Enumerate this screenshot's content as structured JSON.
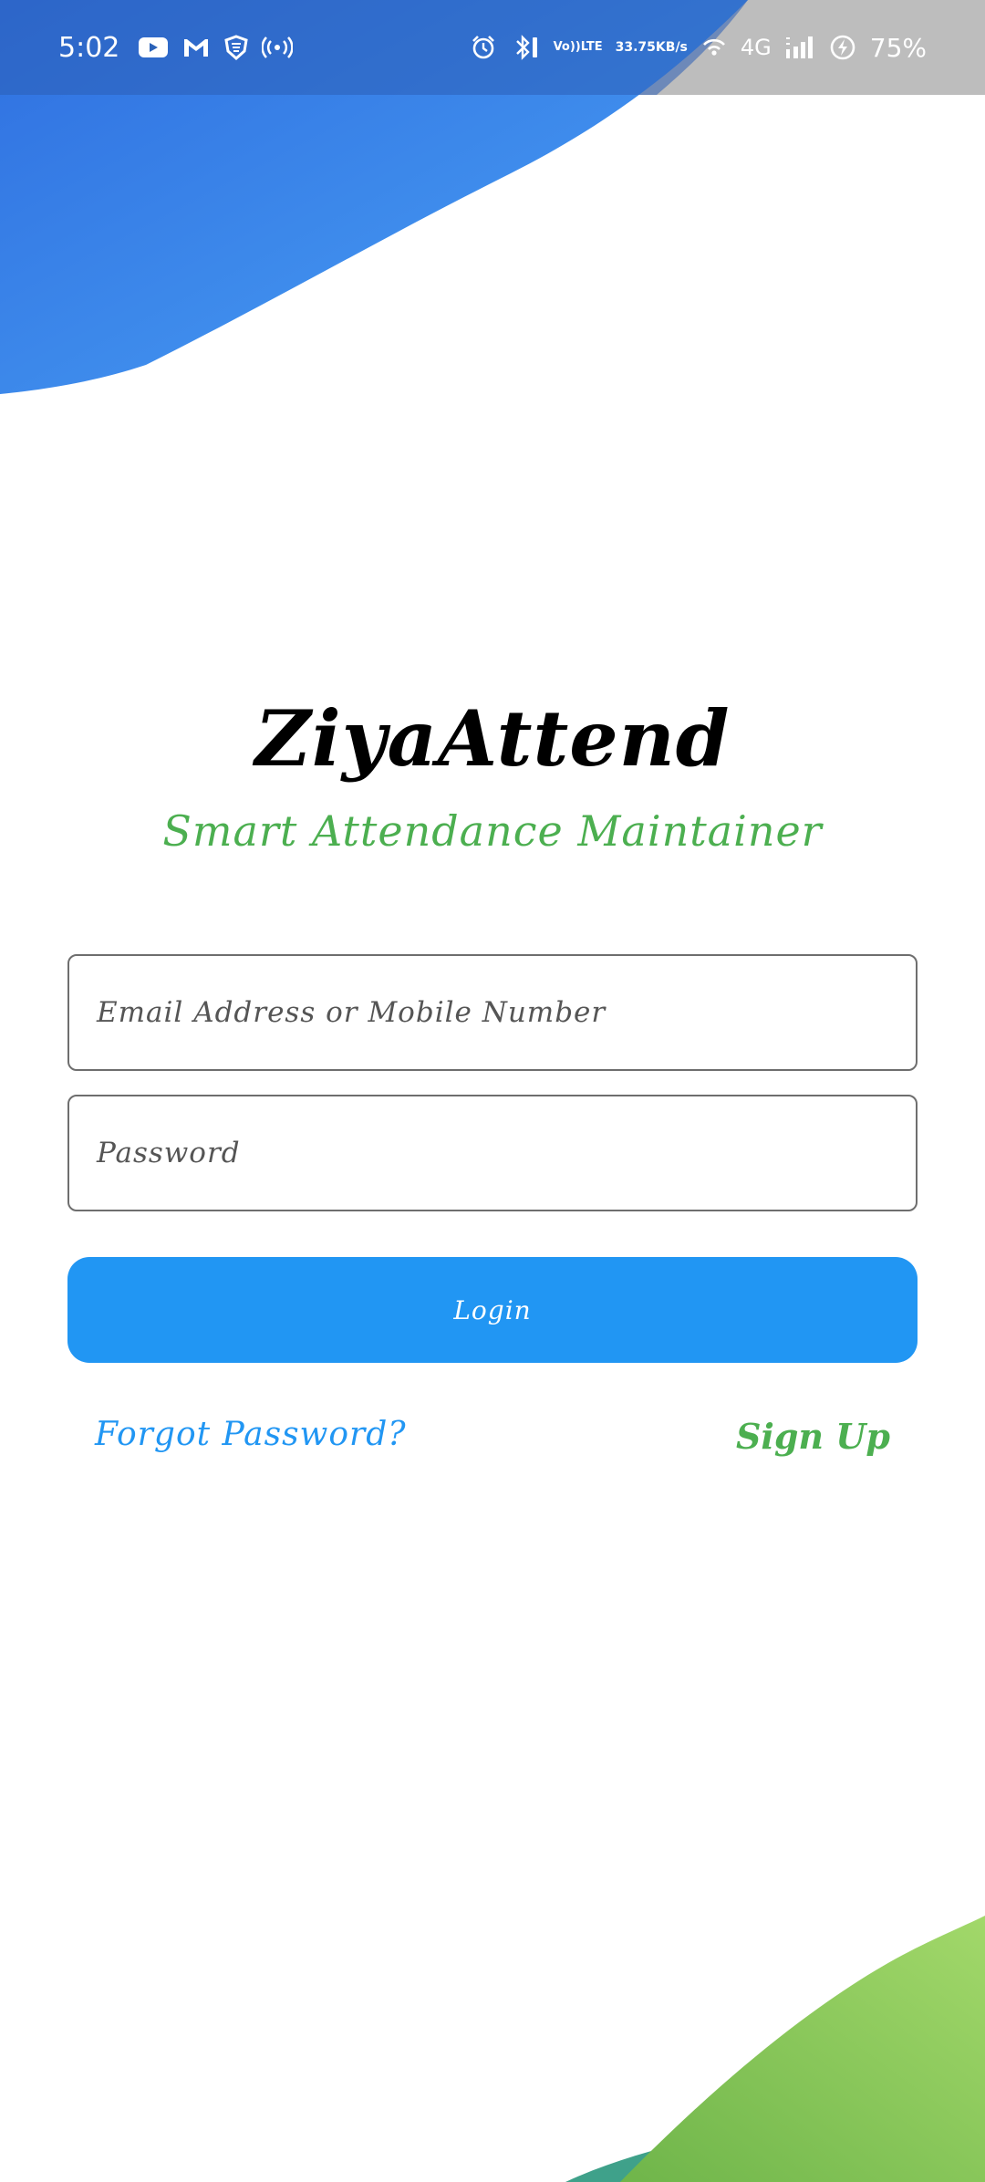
{
  "status_bar": {
    "time": "5:02",
    "left_icons": [
      "youtube-icon",
      "gmail-icon",
      "vpn-shield-icon",
      "hotspot-icon"
    ],
    "right_icons": [
      "alarm-icon",
      "bluetooth-icon",
      "volte-icon",
      "network-speed",
      "wifi-icon",
      "signal-4g-icon",
      "battery-charging-icon"
    ],
    "volte_label_1": "Vo))",
    "volte_label_2": "LTE",
    "net_speed_value": "33.75",
    "net_speed_unit": "KB/s",
    "network_type": "4G",
    "battery": "75%"
  },
  "app": {
    "title": "ZiyaAttend",
    "subtitle": "Smart Attendance Maintainer"
  },
  "form": {
    "email_placeholder": "Email Address or Mobile Number",
    "password_placeholder": "Password",
    "login_label": "Login",
    "forgot_label": "Forgot Password?",
    "signup_label": "Sign Up"
  },
  "colors": {
    "primary_blue": "#2196f3",
    "accent_green": "#4caf50",
    "status_bar_blue": "#2b62b8",
    "status_bar_gray": "#bdbdbd"
  }
}
